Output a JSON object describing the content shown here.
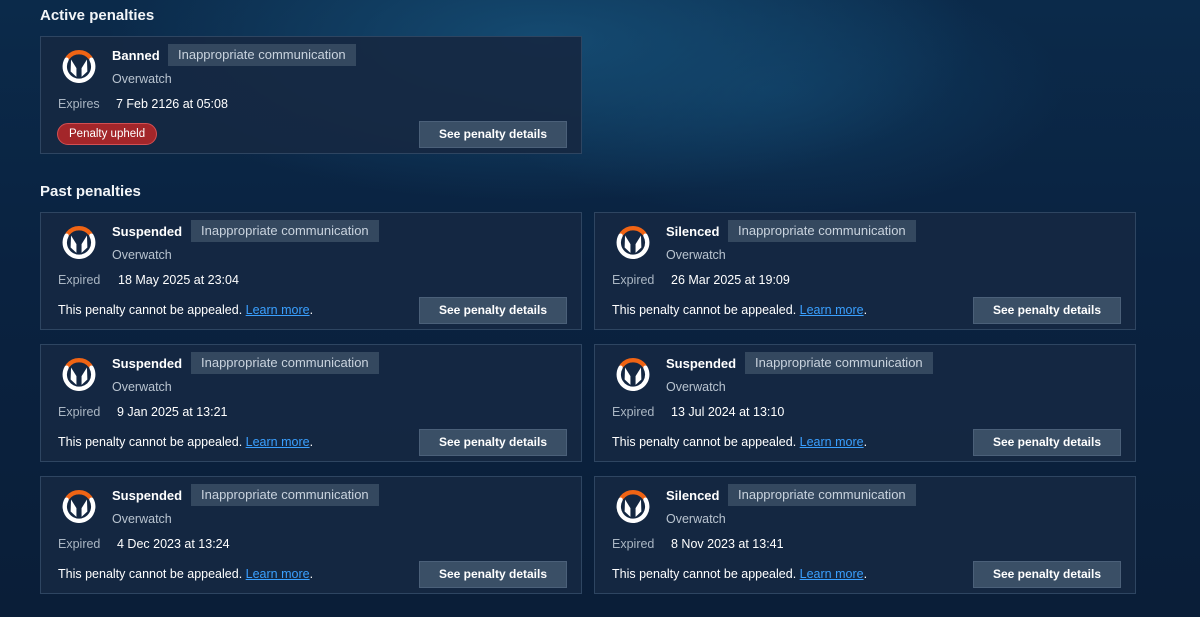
{
  "sections": {
    "active_title": "Active penalties",
    "past_title": "Past penalties"
  },
  "colors": {
    "logo_orange": "#f06414",
    "logo_white": "#ffffff",
    "badge_red": "#a3262a",
    "link_blue": "#3aa0ff"
  },
  "active": {
    "status": "Banned",
    "tag": "Inappropriate communication",
    "game": "Overwatch",
    "exp_label": "Expires",
    "exp_date": "7 Feb 2126 at 05:08",
    "badge": "Penalty upheld",
    "button": "See penalty details",
    "icon": "overwatch-logo-icon"
  },
  "past": [
    {
      "status": "Suspended",
      "tag": "Inappropriate communication",
      "game": "Overwatch",
      "exp_label": "Expired",
      "exp_date": "18 May 2025 at 23:04",
      "note_text": "This penalty cannot be appealed.",
      "note_link": "Learn more",
      "note_end": ".",
      "button": "See penalty details"
    },
    {
      "status": "Silenced",
      "tag": "Inappropriate communication",
      "game": "Overwatch",
      "exp_label": "Expired",
      "exp_date": "26 Mar 2025 at 19:09",
      "note_text": "This penalty cannot be appealed.",
      "note_link": "Learn more",
      "note_end": ".",
      "button": "See penalty details"
    },
    {
      "status": "Suspended",
      "tag": "Inappropriate communication",
      "game": "Overwatch",
      "exp_label": "Expired",
      "exp_date": "9 Jan 2025 at 13:21",
      "note_text": "This penalty cannot be appealed.",
      "note_link": "Learn more",
      "note_end": ".",
      "button": "See penalty details"
    },
    {
      "status": "Suspended",
      "tag": "Inappropriate communication",
      "game": "Overwatch",
      "exp_label": "Expired",
      "exp_date": "13 Jul 2024 at 13:10",
      "note_text": "This penalty cannot be appealed.",
      "note_link": "Learn more",
      "note_end": ".",
      "button": "See penalty details"
    },
    {
      "status": "Suspended",
      "tag": "Inappropriate communication",
      "game": "Overwatch",
      "exp_label": "Expired",
      "exp_date": "4 Dec 2023 at 13:24",
      "note_text": "This penalty cannot be appealed.",
      "note_link": "Learn more",
      "note_end": ".",
      "button": "See penalty details"
    },
    {
      "status": "Silenced",
      "tag": "Inappropriate communication",
      "game": "Overwatch",
      "exp_label": "Expired",
      "exp_date": "8 Nov 2023 at 13:41",
      "note_text": "This penalty cannot be appealed.",
      "note_link": "Learn more",
      "note_end": ".",
      "button": "See penalty details"
    }
  ]
}
